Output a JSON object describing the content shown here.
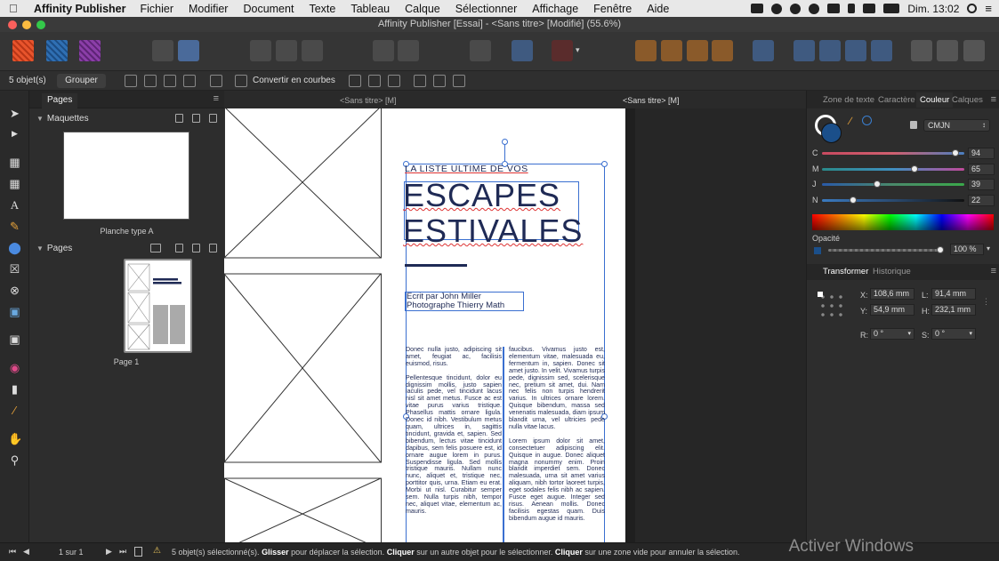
{
  "menubar": {
    "app_name": "Affinity Publisher",
    "menus": [
      "Fichier",
      "Modifier",
      "Document",
      "Texte",
      "Tableau",
      "Calque",
      "Sélectionner",
      "Affichage",
      "Fenêtre",
      "Aide"
    ],
    "clock": "Dim. 13:02"
  },
  "window": {
    "title": "Affinity Publisher [Essai] - <Sans titre> [Modifié] (55.6%)"
  },
  "context_bar": {
    "selection_count": "5 objet(s)",
    "group_button": "Grouper",
    "convert_button": "Convertir en courbes"
  },
  "pages_panel": {
    "tab": "Pages",
    "masters_header": "Maquettes",
    "master_label": "Planche type A",
    "pages_header": "Pages",
    "page_label": "Page 1"
  },
  "canvas": {
    "doc_tab_1": "<Sans titre> [M]",
    "doc_tab_2": "<Sans titre> [M]",
    "kicker": "LA LISTE ULTIME DE VOS",
    "title_line_1": "ESCAPES",
    "title_line_2": "ESTIVALES",
    "byline_1": "Ecrit par John Miller",
    "byline_2": "Photographe Thierry Math",
    "col_left": "Donec nulla justo, adipiscing sit amet, feugiat ac, facilisis euismod, risus.\n\nPellentesque tincidunt, dolor eu dignissim mollis, justo sapien iaculis pede, vel tincidunt lacus nisl sit amet metus. Fusce ac est vitae purus varius tristique. Phasellus mattis ornare ligula. Donec id nibh. Vestibulum metus quam, ultrices in, sagittis tincidunt, gravida et, sapien. Sed bibendum, lectus vitae tincidunt dapibus, sem felis posuere est, id ornare augue lorem in purus. Suspendisse ligula. Sed mollis tristique mauris. Nullam nunc nunc, aliquet et, tristique nec, porttitor quis, urna. Etiam eu erat. Morbi ut nisl. Curabitur semper sem. Nulla turpis nibh, tempor nec, aliquet vitae, elementum ac, mauris.",
    "col_right": "faucibus. Vivamus justo est, elementum vitae, malesuada eu, fermentum in, sapien. Donec sit amet justo. In velit. Vivamus turpis pede, dignissim sed, scelerisque nec, pretium sit amet, dui. Nam nec felis non turpis hendrerit varius. In ultrices ornare lorem. Quisque bibendum, massa sed venenatis malesuada, diam ipsum blandit urna, vel ultricies pede nulla vitae lacus.\n\nLorem ipsum dolor sit amet, consectetuer adipiscing elit. Quisque in augue. Donec aliquet magna nonummy enim. Proin blandit imperdiet sem. Donec malesuada, urna sit amet varius aliquam, nibh tortor laoreet turpis, eget sodales felis nibh ac sapien. Fusce eget augue. Integer sed risus. Aenean mollis. Donec facilisis egestas quam. Duis bibendum augue id mauris."
  },
  "right_panel": {
    "tabs": [
      "Zone de texte",
      "Caractère",
      "Couleur",
      "Calques"
    ],
    "active_tab": "Couleur",
    "color_model": "CMJN",
    "channels": [
      {
        "label": "C",
        "value": "94",
        "level": 0.94
      },
      {
        "label": "M",
        "value": "65",
        "level": 0.65
      },
      {
        "label": "J",
        "value": "39",
        "level": 0.39
      },
      {
        "label": "N",
        "value": "22",
        "level": 0.22
      }
    ],
    "opacity_label": "Opacité",
    "opacity_value": "100 %",
    "transform_tabs": [
      "Transformer",
      "Historique"
    ],
    "transform": {
      "x_label": "X:",
      "x": "108,6 mm",
      "y_label": "Y:",
      "y": "54,9 mm",
      "w_label": "L:",
      "w": "91,4 mm",
      "h_label": "H:",
      "h": "232,1 mm",
      "r_label": "R:",
      "r": "0 °",
      "s_label": "S:",
      "s": "0 °"
    }
  },
  "statusbar": {
    "page_nav": "1 sur 1",
    "msg_intro": "5 objet(s) sélectionné(s).",
    "k1": "Glisser",
    "t1": "pour déplacer la sélection.",
    "k2": "Cliquer",
    "t2": "sur un autre objet pour le sélectionner.",
    "k3": "Cliquer",
    "t3": "sur une zone vide pour annuler la sélection."
  },
  "watermark": "Activer Windows",
  "colors": {
    "ink": "#1f2a55",
    "selection": "#3a6fd0",
    "accent_red": "#e0352b"
  }
}
